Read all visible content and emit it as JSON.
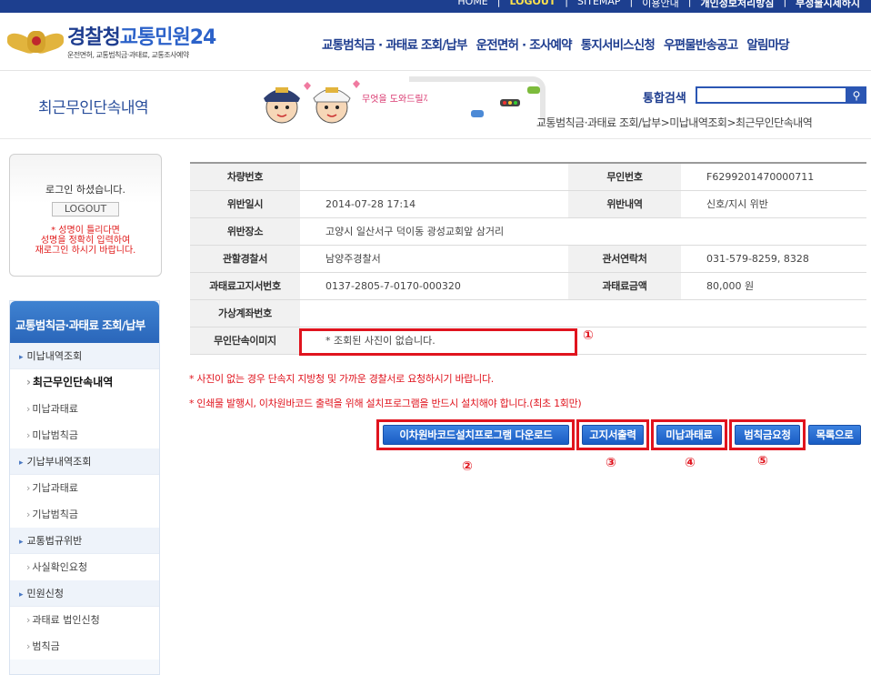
{
  "topbar": {
    "links": [
      "HOME",
      "LOGOUT",
      "SITEMAP",
      "이용안내",
      "개인정보처리방침",
      "부정불시제하지"
    ]
  },
  "header": {
    "logo_title_1": "경찰청",
    "logo_title_2": "교통민원24",
    "logo_subtitle": "운전면허, 교통범칙금·과태료, 교통조사예약",
    "nav": [
      "교통범칙금 · 과태료 조회/납부",
      "운전면허 · 조사예약",
      "통지서비스신청",
      "우편물반송공고",
      "알림마당"
    ]
  },
  "banner": {
    "page_title": "최근무인단속내역",
    "speech": "무엇을 도와드릴까요?",
    "search_label": "통합검색",
    "search_value": "",
    "breadcrumb": "교통범칙금·과태료 조회/납부>미납내역조회>최근무인단속내역"
  },
  "login": {
    "message": "로그인 하셨습니다.",
    "logout_label": "LOGOUT",
    "warn_1": "* 성명이 틀리다면",
    "warn_2": "성명을 정확히 입력하여",
    "warn_3": "재로그인 하시기 바랍니다."
  },
  "sidemenu": {
    "title": "교통범칙금·과태료 조회/납부",
    "items": [
      {
        "label": "미납내역조회",
        "type": "group"
      },
      {
        "label": "최근무인단속내역",
        "type": "sub",
        "active": true
      },
      {
        "label": "미납과태료",
        "type": "sub"
      },
      {
        "label": "미납범칙금",
        "type": "sub"
      },
      {
        "label": "기납부내역조회",
        "type": "group"
      },
      {
        "label": "기납과태료",
        "type": "sub"
      },
      {
        "label": "기납범칙금",
        "type": "sub"
      },
      {
        "label": "교통법규위반",
        "type": "group"
      },
      {
        "label": "사실확인요청",
        "type": "sub"
      },
      {
        "label": "민원신청",
        "type": "group"
      },
      {
        "label": "과태료 법인신청",
        "type": "sub"
      },
      {
        "label": "범칙금",
        "type": "sub"
      }
    ]
  },
  "detail": {
    "vehicle_no_label": "차량번호",
    "vehicle_no": "",
    "unmanned_no_label": "무인번호",
    "unmanned_no": "F6299201470000711",
    "date_label": "위반일시",
    "date": "2014-07-28 17:14",
    "violation_label": "위반내역",
    "violation": "신호/지시 위반",
    "place_label": "위반장소",
    "place": "고양시 일산서구 덕이동 광성교회앞 삼거리",
    "station_label": "관할경찰서",
    "station": "남양주경찰서",
    "contact_label": "관서연락처",
    "contact": "031-579-8259, 8328",
    "notice_no_label": "과태료고지서번호",
    "notice_no": "0137-2805-7-0170-000320",
    "amount_label": "과태료금액",
    "amount": "80,000 원",
    "virtual_account_label": "가상계좌번호",
    "virtual_account": "",
    "image_label": "무인단속이미지",
    "image_value": "* 조회된 사진이 없습니다."
  },
  "notices": {
    "line1": "* 사진이 없는 경우 단속지 지방청 및 가까운 경찰서로 요청하시기 바랍니다.",
    "line2": "* 인쇄물 발행시, 이차원바코드 출력을 위해 설치프로그램을 반드시 설치해야 합니다.(최초 1회만)"
  },
  "buttons": {
    "barcode": "이차원바코드설치프로그램 다운로드",
    "print": "고지서출력",
    "unpaid": "미납과태료",
    "fine": "범칙금요청",
    "list": "목록으로"
  },
  "markers": [
    "①",
    "②",
    "③",
    "④",
    "⑤"
  ],
  "colors": {
    "brand": "#1e3d8f",
    "button": "#1a5dc4",
    "highlight": "#e0141e"
  }
}
